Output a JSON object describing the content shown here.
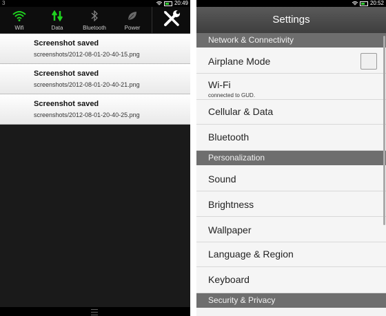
{
  "left": {
    "status_left": "3",
    "time": "20:49",
    "toggles": [
      {
        "label": "Wifi",
        "icon": "wifi-icon",
        "active": true
      },
      {
        "label": "Data",
        "icon": "data-arrows-icon",
        "active": true
      },
      {
        "label": "Bluetooth",
        "icon": "bluetooth-icon",
        "active": false
      },
      {
        "label": "Power",
        "icon": "leaf-icon",
        "active": false
      }
    ],
    "tools_icon": "wrench-screwdriver-icon",
    "notifications": [
      {
        "title": "Screenshot saved",
        "path": "screenshots/2012-08-01-20-40-15.png"
      },
      {
        "title": "Screenshot saved",
        "path": "screenshots/2012-08-01-20-40-21.png"
      },
      {
        "title": "Screenshot saved",
        "path": "screenshots/2012-08-01-20-40-25.png"
      }
    ]
  },
  "right": {
    "time": "20:52",
    "title": "Settings",
    "sections": {
      "network": "Network & Connectivity",
      "personalization": "Personalization",
      "security": "Security & Privacy"
    },
    "rows": {
      "airplane": "Airplane Mode",
      "wifi": "Wi-Fi",
      "wifi_status": "connected to GUD.",
      "cellular": "Cellular & Data",
      "bluetooth": "Bluetooth",
      "sound": "Sound",
      "brightness": "Brightness",
      "wallpaper": "Wallpaper",
      "language": "Language & Region",
      "keyboard": "Keyboard"
    },
    "airplane_checked": false
  },
  "colors": {
    "toggle_active": "#1fd21f",
    "toggle_inactive": "#8a8a8a",
    "section_bg": "#6e6e6e",
    "titlebar_bg": "#4a4a4a"
  }
}
